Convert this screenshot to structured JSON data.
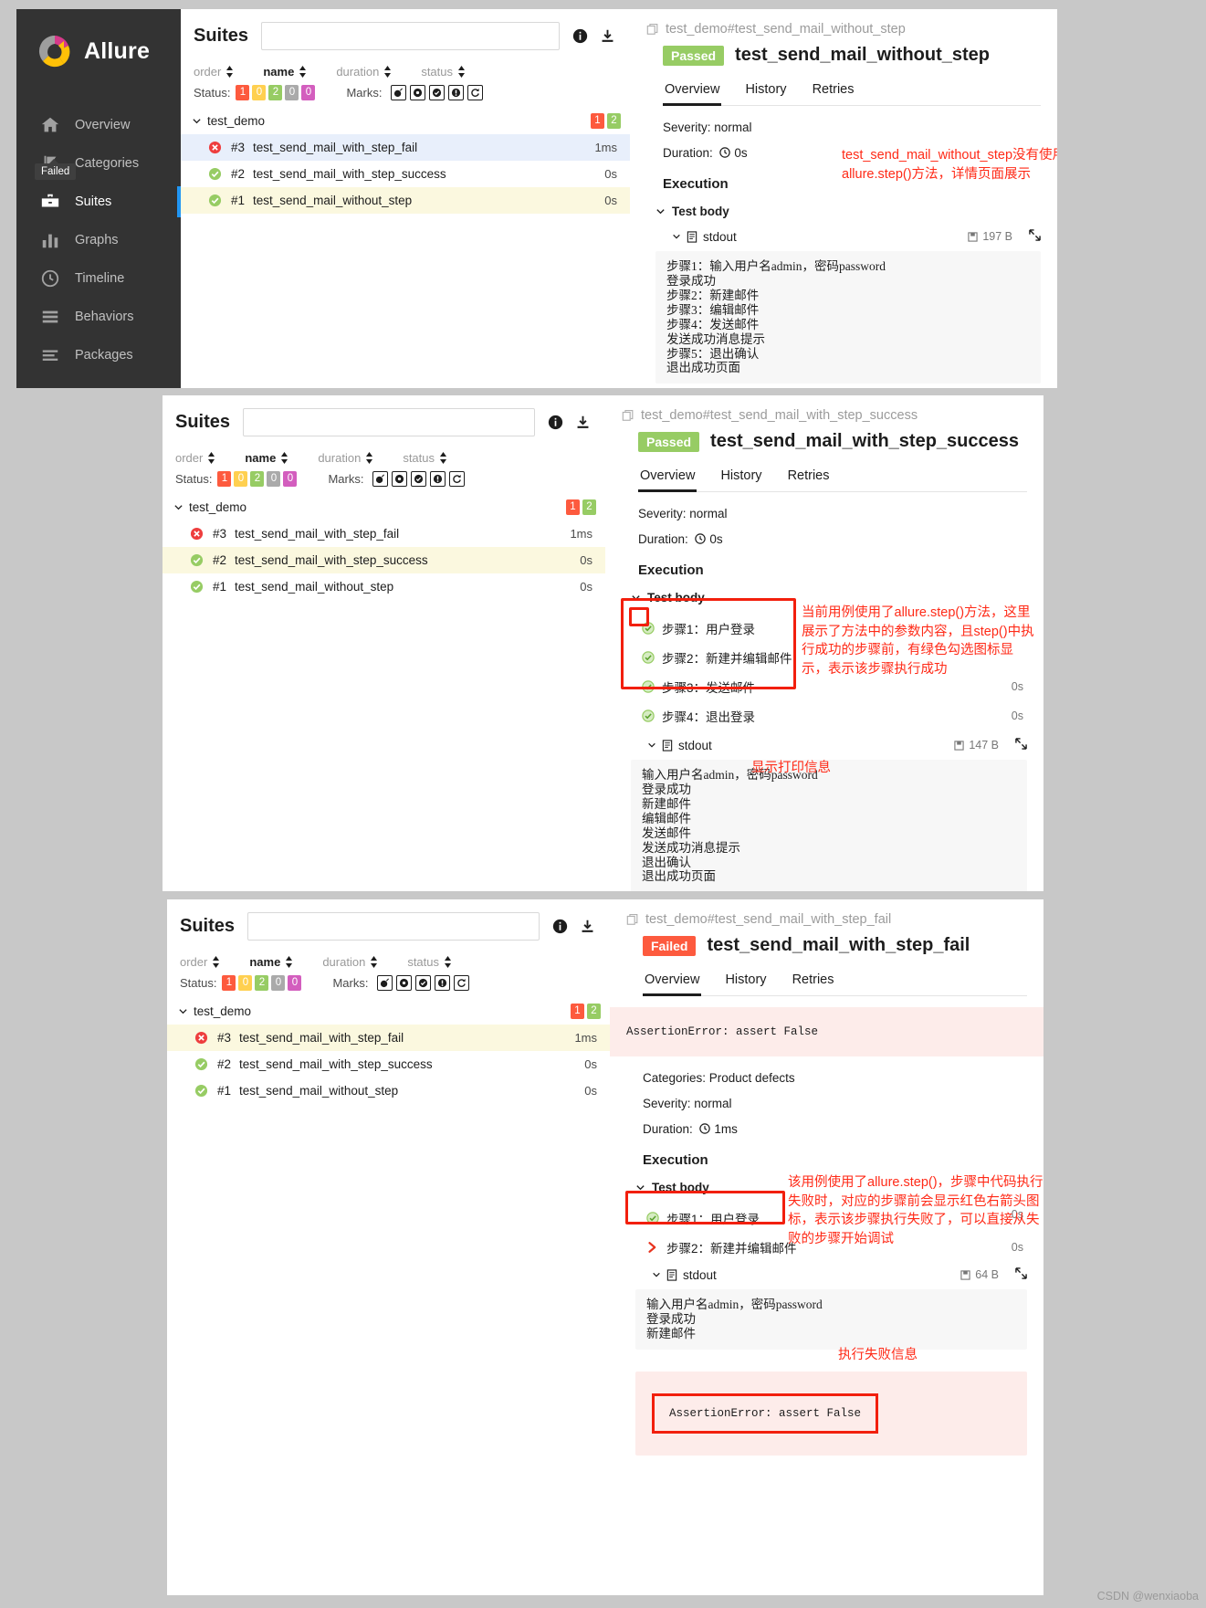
{
  "brand": {
    "name": "Allure"
  },
  "sidebar": {
    "items": [
      {
        "label": "Overview",
        "icon": "home-icon",
        "active": false
      },
      {
        "label": "Categories",
        "icon": "flag-icon",
        "active": false
      },
      {
        "label": "Suites",
        "icon": "suitcase-icon",
        "active": true
      },
      {
        "label": "Graphs",
        "icon": "bar-chart-icon",
        "active": false
      },
      {
        "label": "Timeline",
        "icon": "clock-icon",
        "active": false
      },
      {
        "label": "Behaviors",
        "icon": "list-icon",
        "active": false
      },
      {
        "label": "Packages",
        "icon": "stack-icon",
        "active": false
      }
    ]
  },
  "suites": {
    "title": "Suites",
    "search_placeholder": "",
    "search_value": "",
    "icons": {
      "info": "info-icon",
      "download": "download-icon"
    },
    "sorters": [
      {
        "label": "order",
        "active": false
      },
      {
        "label": "name",
        "active": true
      },
      {
        "label": "duration",
        "active": false
      },
      {
        "label": "status",
        "active": false
      }
    ],
    "status_label": "Status:",
    "status_chips": [
      {
        "value": "1",
        "color": "#fd5a3e"
      },
      {
        "value": "0",
        "color": "#ffd050"
      },
      {
        "value": "2",
        "color": "#97cc64"
      },
      {
        "value": "0",
        "color": "#aaaaaa"
      },
      {
        "value": "0",
        "color": "#d35ebe"
      }
    ],
    "marks_label": "Marks:",
    "marks": [
      "bomb-icon",
      "gear-icon",
      "check-shield-icon",
      "exclamation-icon",
      "retry-icon"
    ],
    "tree": {
      "name": "test_demo",
      "counts": [
        {
          "value": "1",
          "color": "#fd5a3e"
        },
        {
          "value": "2",
          "color": "#97cc64"
        }
      ]
    },
    "cases": [
      {
        "num": "#3",
        "name": "test_send_mail_with_step_fail",
        "duration": "1ms",
        "status": "failed"
      },
      {
        "num": "#2",
        "name": "test_send_mail_with_step_success",
        "duration": "0s",
        "status": "passed"
      },
      {
        "num": "#1",
        "name": "test_send_mail_without_step",
        "duration": "0s",
        "status": "passed"
      }
    ],
    "tooltip": "Failed"
  },
  "panel1": {
    "breadcrumb": "test_demo#test_send_mail_without_step",
    "badge": "Passed",
    "badge_color": "#97cc64",
    "title": "test_send_mail_without_step",
    "tabs": [
      {
        "label": "Overview",
        "active": true
      },
      {
        "label": "History",
        "active": false
      },
      {
        "label": "Retries",
        "active": false
      }
    ],
    "severity": "Severity: normal",
    "duration_label": "Duration:",
    "duration": "0s",
    "execution": "Execution",
    "test_body": "Test body",
    "stdout_label": "stdout",
    "stdout_size": "197 B",
    "stdout": "步骤1：输入用户名admin，密码password\n登录成功\n步骤2：新建邮件\n步骤3：编辑邮件\n步骤4：发送邮件\n发送成功消息提示\n步骤5：退出确认\n退出成功页面",
    "selected_case_index": 2,
    "highlight_case_index": 0,
    "annotation": "test_send_mail_without_step没有使用allure.step()方法，详情页面展示"
  },
  "panel2": {
    "breadcrumb": "test_demo#test_send_mail_with_step_success",
    "badge": "Passed",
    "badge_color": "#97cc64",
    "title": "test_send_mail_with_step_success",
    "tabs": [
      {
        "label": "Overview",
        "active": true
      },
      {
        "label": "History",
        "active": false
      },
      {
        "label": "Retries",
        "active": false
      }
    ],
    "severity": "Severity: normal",
    "duration_label": "Duration:",
    "duration": "0s",
    "execution": "Execution",
    "test_body": "Test body",
    "steps": [
      {
        "label": "步骤1：用户登录",
        "status": "passed",
        "duration": ""
      },
      {
        "label": "步骤2：新建并编辑邮件",
        "status": "passed",
        "duration": ""
      },
      {
        "label": "步骤3：发送邮件",
        "status": "passed",
        "duration": "0s"
      },
      {
        "label": "步骤4：退出登录",
        "status": "passed",
        "duration": "0s"
      }
    ],
    "stdout_label": "stdout",
    "stdout_size": "147 B",
    "stdout": "输入用户名admin，密码password\n登录成功\n新建邮件\n编辑邮件\n发送邮件\n发送成功消息提示\n退出确认\n退出成功页面",
    "selected_case_index": 1,
    "annotation": "当前用例使用了allure.step()方法，这里展示了方法中的参数内容，且step()中执行成功的步骤前，有绿色勾选图标显示，表示该步骤执行成功",
    "annotation2": "显示打印信息"
  },
  "panel3": {
    "breadcrumb": "test_demo#test_send_mail_with_step_fail",
    "badge": "Failed",
    "badge_color": "#fd5a3e",
    "title": "test_send_mail_with_step_fail",
    "tabs": [
      {
        "label": "Overview",
        "active": true
      },
      {
        "label": "History",
        "active": false
      },
      {
        "label": "Retries",
        "active": false
      }
    ],
    "error": "AssertionError: assert False",
    "categories": "Categories: Product defects",
    "severity": "Severity: normal",
    "duration_label": "Duration:",
    "duration": "1ms",
    "execution": "Execution",
    "test_body": "Test body",
    "steps": [
      {
        "label": "步骤1：用户登录",
        "status": "passed",
        "duration": ""
      },
      {
        "label": "步骤2：新建并编辑邮件",
        "status": "failed",
        "duration": "0s"
      }
    ],
    "stdout_label": "stdout",
    "stdout_size": "64 B",
    "stdout": "输入用户名admin，密码password\n登录成功\n新建邮件",
    "failure_box": "AssertionError: assert False",
    "selected_case_index": 0,
    "annotation": "该用例使用了allure.step()，步骤中代码执行失败时，对应的步骤前会显示红色右箭头图标，表示该步骤执行失败了，可以直接从失败的步骤开始调试",
    "annotation2": "执行失败信息",
    "trailing_dur": "0s"
  },
  "watermark": "CSDN @wenxiaoba"
}
